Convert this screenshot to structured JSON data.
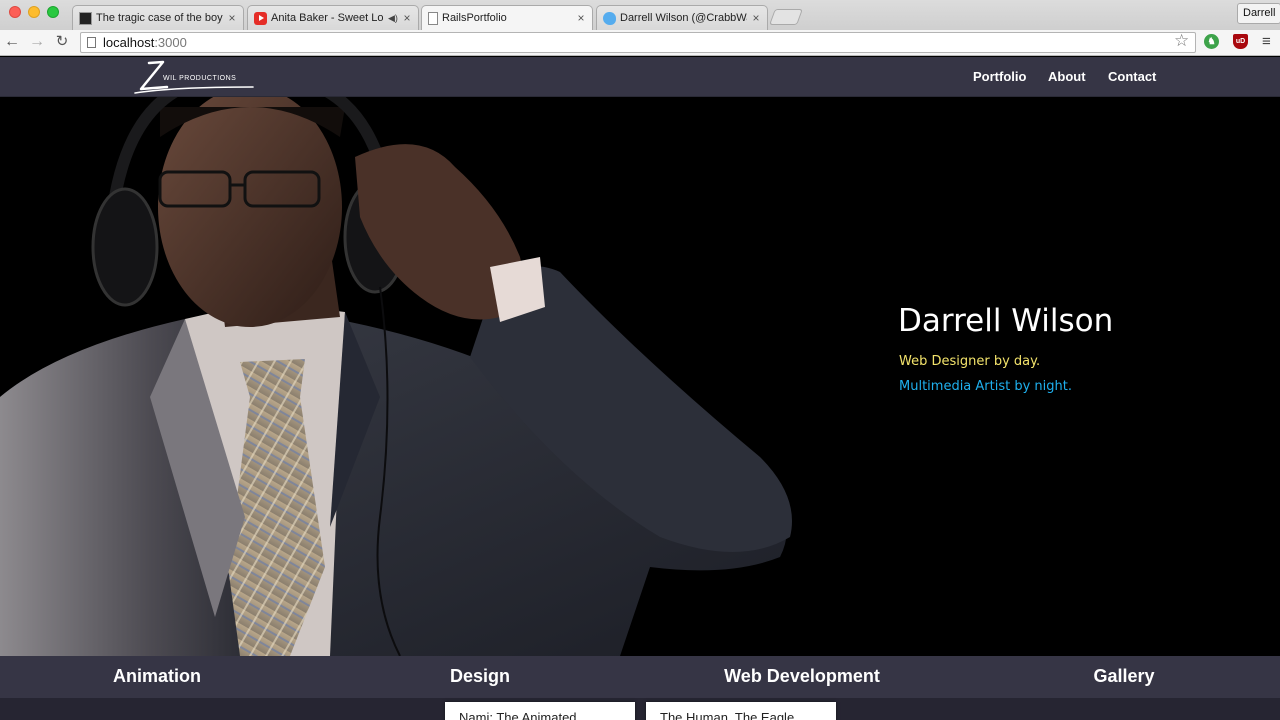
{
  "browser": {
    "tabs": [
      {
        "title": "The tragic case of the boy",
        "favicon": "lulu-icon"
      },
      {
        "title": "Anita Baker - Sweet Lo",
        "favicon": "youtube-icon",
        "audio": "speaker-icon"
      },
      {
        "title": "RailsPortfolio",
        "favicon": "page-icon",
        "active": true
      },
      {
        "title": "Darrell Wilson (@CrabbWa",
        "favicon": "twitter-icon"
      }
    ],
    "close_glyph": "×",
    "profile_name": "Darrell",
    "url_host": "localhost",
    "url_port": ":3000",
    "icons": {
      "back": "←",
      "forward": "→",
      "reload": "↻",
      "star": "☆",
      "menu": "≡",
      "speaker": "◀)"
    },
    "extensions": {
      "green_badge": "♞",
      "ublock_badge": "uD"
    }
  },
  "site": {
    "logo_text": "WIL PRODUCTIONS",
    "nav": {
      "portfolio": "Portfolio",
      "about": "About",
      "contact": "Contact"
    },
    "hero": {
      "name": "Darrell Wilson",
      "tagline_day": "Web Designer by day.",
      "tagline_night": "Multimedia Artist by night."
    },
    "categories": [
      "Animation",
      "Design",
      "Web Development",
      "Gallery"
    ],
    "cards": [
      "Nami: The Animated",
      "The Human, The Eagle"
    ]
  },
  "colors": {
    "nav_bg": "#363545",
    "tagline_day": "#f3e36b",
    "tagline_night": "#1fb0ee"
  }
}
